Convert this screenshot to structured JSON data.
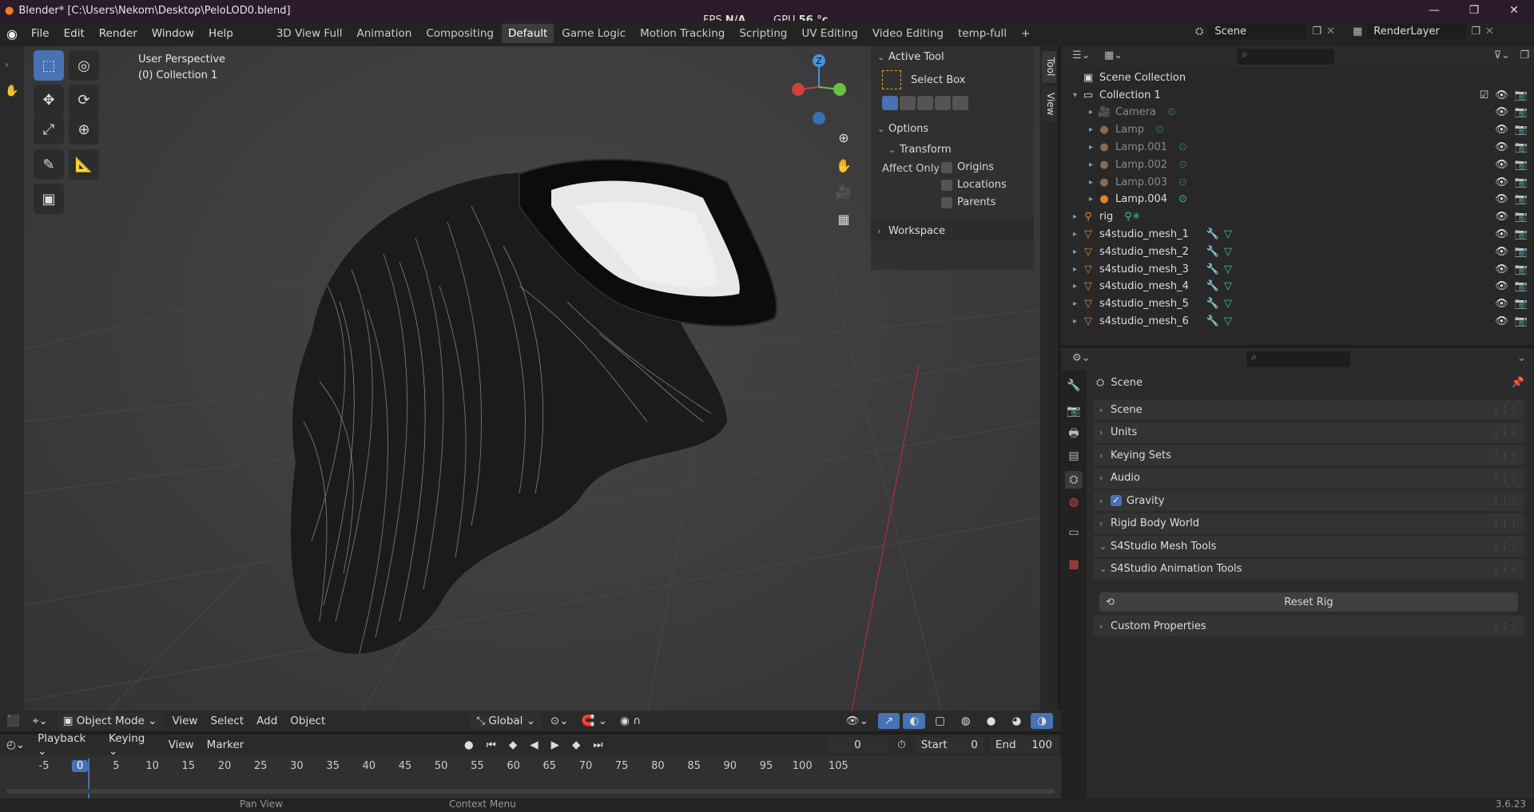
{
  "window": {
    "title": "Blender* [C:\\Users\\Nekom\\Desktop\\PeloLOD0.blend]",
    "controls": [
      "—",
      "❐",
      "✕"
    ]
  },
  "menu": {
    "items": [
      "File",
      "Edit",
      "Render",
      "Window",
      "Help"
    ]
  },
  "workspaces": {
    "tabs": [
      "3D View Full",
      "Animation",
      "Compositing",
      "Default",
      "Game Logic",
      "Motion Tracking",
      "Scripting",
      "UV Editing",
      "Video Editing",
      "temp-full",
      "+"
    ],
    "active": "Default"
  },
  "perf": {
    "fps_label": "FPS",
    "fps_value": "N/A",
    "gpu_label": "GPU",
    "gpu_value": "56 °c"
  },
  "scene_selector": {
    "value": "Scene"
  },
  "layer_selector": {
    "value": "RenderLayer"
  },
  "viewport": {
    "perspective": "User Perspective",
    "collection": "(0) Collection 1",
    "gizmo_axis": "Z"
  },
  "active_tool": {
    "header": "Active Tool",
    "tool_name": "Select Box"
  },
  "options": {
    "header": "Options",
    "transform": "Transform",
    "affect_only": "Affect Only",
    "checks": [
      "Origins",
      "Locations",
      "Parents"
    ],
    "workspace": "Workspace"
  },
  "npanel_tabs": [
    "Tool",
    "View"
  ],
  "viewport_header": {
    "mode": "Object Mode",
    "menus": [
      "View",
      "Select",
      "Add",
      "Object"
    ],
    "orientation": "Global"
  },
  "timeline": {
    "menus": [
      "Playback",
      "Keying",
      "View",
      "Marker"
    ],
    "current_frame": "0",
    "start_label": "Start",
    "start_value": "0",
    "end_label": "End",
    "end_value": "100",
    "ticks": [
      "-5",
      "0",
      "5",
      "10",
      "15",
      "20",
      "25",
      "30",
      "35",
      "40",
      "45",
      "50",
      "55",
      "60",
      "65",
      "70",
      "75",
      "80",
      "85",
      "90",
      "95",
      "100",
      "105"
    ]
  },
  "statusbar": {
    "left": "Pan View",
    "middle": "Context Menu",
    "version": "3.6.23"
  },
  "outliner": {
    "root": "Scene Collection",
    "rows": [
      {
        "label": "Collection 1",
        "icon": "collection",
        "level": 1
      },
      {
        "label": "Camera",
        "icon": "camera",
        "level": 2,
        "dim": true
      },
      {
        "label": "Lamp",
        "icon": "light",
        "level": 2,
        "dim": true
      },
      {
        "label": "Lamp.001",
        "icon": "light",
        "level": 2,
        "dim": true
      },
      {
        "label": "Lamp.002",
        "icon": "light",
        "level": 2,
        "dim": true
      },
      {
        "label": "Lamp.003",
        "icon": "light",
        "level": 2,
        "dim": true
      },
      {
        "label": "Lamp.004",
        "icon": "light",
        "level": 2,
        "dim": false
      },
      {
        "label": "rig",
        "icon": "armature",
        "level": 1
      },
      {
        "label": "s4studio_mesh_1",
        "icon": "mesh",
        "level": 1
      },
      {
        "label": "s4studio_mesh_2",
        "icon": "mesh",
        "level": 1
      },
      {
        "label": "s4studio_mesh_3",
        "icon": "mesh",
        "level": 1
      },
      {
        "label": "s4studio_mesh_4",
        "icon": "mesh",
        "level": 1
      },
      {
        "label": "s4studio_mesh_5",
        "icon": "mesh",
        "level": 1
      },
      {
        "label": "s4studio_mesh_6",
        "icon": "mesh",
        "level": 1
      }
    ]
  },
  "properties": {
    "context": "Scene",
    "panels": [
      {
        "label": "Scene",
        "open": false
      },
      {
        "label": "Units",
        "open": false
      },
      {
        "label": "Keying Sets",
        "open": false
      },
      {
        "label": "Audio",
        "open": false
      },
      {
        "label": "Gravity",
        "open": false,
        "checkbox": true
      },
      {
        "label": "Rigid Body World",
        "open": false
      },
      {
        "label": "S4Studio Mesh Tools",
        "open": true
      },
      {
        "label": "S4Studio Animation Tools",
        "open": true
      },
      {
        "label": "Custom Properties",
        "open": false
      }
    ],
    "reset_rig": "Reset Rig"
  },
  "colors": {
    "accent": "#4772b3",
    "mesh_orange": "#e0832f",
    "modifier_blue": "#6b9fe0",
    "data_green": "#46c18f"
  }
}
